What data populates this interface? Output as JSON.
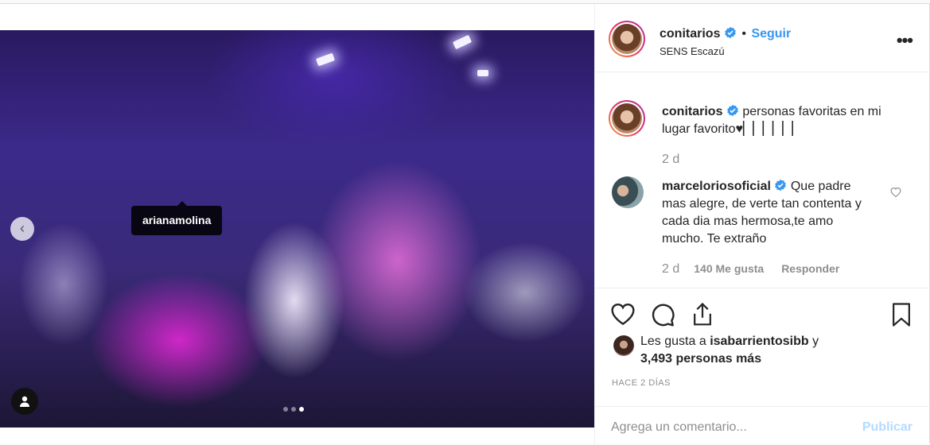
{
  "post": {
    "image_tag": "arianamolina",
    "carousel": {
      "count": 3,
      "active_index": 2
    }
  },
  "header": {
    "username": "conitarios",
    "separator": "•",
    "follow_label": "Seguir",
    "location": "SENS Escazú",
    "more_icon": "ellipsis-icon"
  },
  "caption": {
    "username": "conitarios",
    "text": "personas favoritas en mi lugar favorito♥▏▏▏▏▏▏",
    "time": "2 d"
  },
  "comment": {
    "username": "marceloriosoficial",
    "text": "Que padre mas alegre, de verte tan contenta y cada dia mas hermosa,te amo mucho. Te extraño",
    "time": "2 d",
    "likes": "140 Me gusta",
    "reply_label": "Responder"
  },
  "likes": {
    "prefix": "Les gusta a",
    "first_user": "isabarrientosibb",
    "conj": "y",
    "others": "3,493 personas más"
  },
  "timestamp": "HACE 2 DÍAS",
  "composer": {
    "placeholder": "Agrega un comentario...",
    "publish_label": "Publicar"
  },
  "colors": {
    "accent": "#3897f0",
    "publish_disabled": "#b3dbff",
    "muted": "#8e8e8e"
  }
}
